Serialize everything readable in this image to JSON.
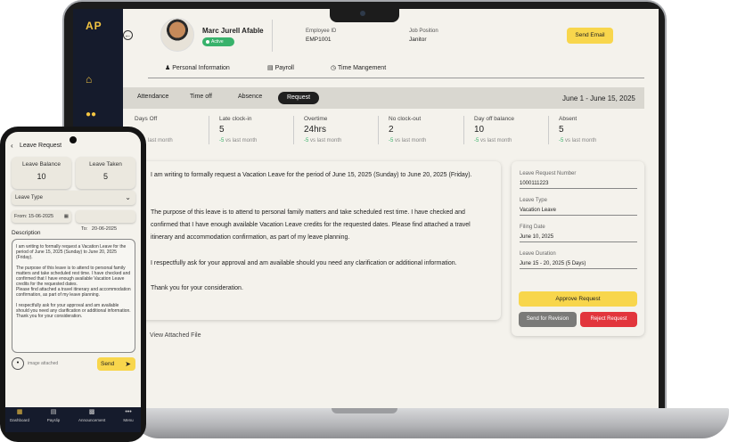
{
  "app": {
    "logo": "AP"
  },
  "sidebar": {
    "icons": [
      "home-icon",
      "people-icon"
    ]
  },
  "employee": {
    "name": "Marc Jurell Afable",
    "status": "Active",
    "id_label": "Employee ID",
    "id": "EMP1001",
    "position_label": "Job Position",
    "position": "Janitor"
  },
  "header": {
    "send_email": "Send Email"
  },
  "profile_tabs": [
    {
      "label": "Personal Information",
      "icon": "person-icon"
    },
    {
      "label": "Payroll",
      "icon": "payroll-icon"
    },
    {
      "label": "Time Mangement",
      "icon": "clock-icon"
    }
  ],
  "sub_tabs": [
    "Attendance",
    "Time off",
    "Absence",
    "Request"
  ],
  "active_sub_tab": "Request",
  "date_range": "June 1 - June 15, 2025",
  "stats": [
    {
      "label": "Days Off",
      "value": "",
      "delta": "",
      "sub": "last month"
    },
    {
      "label": "Late clock-in",
      "value": "5",
      "delta": "-5",
      "sub": " vs last month"
    },
    {
      "label": "Overtime",
      "value": "24hrs",
      "delta": "-5",
      "sub": " vs last month"
    },
    {
      "label": "No clock-out",
      "value": "2",
      "delta": "-5",
      "sub": " vs last month"
    },
    {
      "label": "Day off balance",
      "value": "10",
      "delta": "-5",
      "sub": " vs last month"
    },
    {
      "label": "Absent",
      "value": "5",
      "delta": "-5",
      "sub": " vs last month"
    }
  ],
  "letter": {
    "p1": "I am writing to formally request a Vacation Leave for the period of June 15, 2025 (Sunday) to June 20, 2025 (Friday).",
    "p2": "The purpose of this leave is to attend to personal family matters and take scheduled rest time. I have checked and confirmed that I have enough available Vacation Leave credits for the requested dates. Please find attached a travel itinerary and accommodation confirmation, as part of my leave planning.",
    "p3": "I respectfully ask for your approval and am available should you need any clarification or additional information.",
    "p4": "Thank you for your consideration.",
    "view_file": "View Attached File"
  },
  "details": {
    "request_number_label": "Leave Request Number",
    "request_number": "1000111223",
    "leave_type_label": "Leave Type",
    "leave_type": "Vacation Leave",
    "filing_date_label": "Filing Date",
    "filing_date": "June 10, 2025",
    "duration_label": "Leave Duration",
    "duration": "June 15 - 20, 2025 (5 Days)",
    "approve": "Approve Request",
    "revision": "Send for Revision",
    "reject": "Reject Request"
  },
  "phone": {
    "title": "Leave Request",
    "balance_label": "Leave Balance",
    "balance": "10",
    "taken_label": "Leave Taken",
    "taken": "5",
    "leave_type_placeholder": "Leave Type",
    "from": "From: 15-06-2025",
    "to": "To:   20-06-2025",
    "description_label": "Description",
    "description": "I am writing to formally request a Vacation Leave for the period of June 15, 2025 (Sunday) to June 20, 2025 (Friday).\n\nThe purpose of this leave is to attend to personal family matters and take scheduled rest time. I have checked and confirmed that I have enough available Vacation Leave credits for the requested dates.\nPlease find attached a travel itinerary and accommodation confirmation, as part of my leave planning.\n\nI respectfully ask for your approval and am available should you need any clarification or additional information.\nThank you for your consideration.",
    "attachment": "image attached",
    "send": "Send",
    "nav": [
      "Dashboard",
      "Payslip",
      "Announcement",
      "Menu"
    ]
  }
}
